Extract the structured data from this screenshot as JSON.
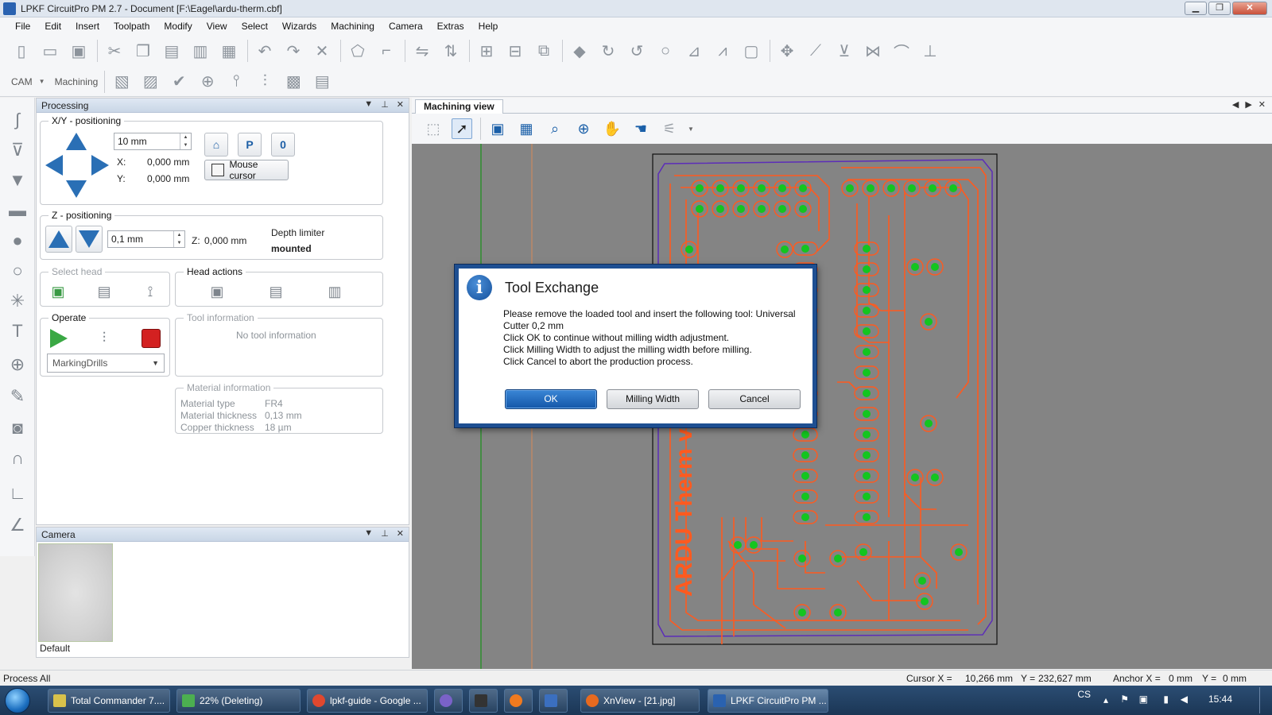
{
  "window": {
    "title": "LPKF CircuitPro PM 2.7 - Document [F:\\Eagel\\ardu-therm.cbf]",
    "min_label": "▁",
    "max_label": "❐",
    "close_label": "✕"
  },
  "menu": [
    "File",
    "Edit",
    "Insert",
    "Toolpath",
    "Modify",
    "View",
    "Select",
    "Wizards",
    "Machining",
    "Camera",
    "Extras",
    "Help"
  ],
  "toolbar2": {
    "cam_label": "CAM",
    "machining_label": "Machining"
  },
  "processing": {
    "panel_title": "Processing",
    "xy": {
      "title": "X/Y - positioning",
      "step_value": "10 mm",
      "x_label": "X:",
      "x_value": "0,000 mm",
      "y_label": "Y:",
      "y_value": "0,000 mm",
      "mouse_cursor_label": "Mouse cursor",
      "btn_p": "P",
      "btn_0": "0"
    },
    "z": {
      "title": "Z - positioning",
      "step_value": "0,1 mm",
      "z_label": "Z:",
      "z_value": "0,000 mm",
      "depth_limiter_label": "Depth limiter",
      "depth_limiter_value": "mounted"
    },
    "select_head_title": "Select head",
    "head_actions_title": "Head actions",
    "operate": {
      "title": "Operate",
      "selected_phase": "MarkingDrills"
    },
    "tool_info": {
      "title": "Tool information",
      "text": "No tool information"
    },
    "material_info": {
      "title": "Material information",
      "type_label": "Material type",
      "type_value": "FR4",
      "thickness_label": "Material thickness",
      "thickness_value": "0,13 mm",
      "copper_label": "Copper thickness",
      "copper_value": "18 µm"
    }
  },
  "camera": {
    "panel_title": "Camera",
    "default_label": "Default"
  },
  "machining_view": {
    "tab_label": "Machining view",
    "board_label": "ARDU Therm v1.0"
  },
  "dialog": {
    "title": "Tool Exchange",
    "line1": "Please remove the loaded tool and insert the following tool: Universal Cutter 0,2 mm",
    "line2": "Click OK to continue without milling width adjustment.",
    "line3": "Click Milling Width to adjust the milling width before milling.",
    "line4": "Click Cancel to abort the production process.",
    "ok": "OK",
    "milling_width": "Milling Width",
    "cancel": "Cancel"
  },
  "statusbar": {
    "left": "Process All",
    "cursor_x_label": "Cursor X =",
    "cursor_x": "10,266 mm",
    "cursor_y_label": "Y =",
    "cursor_y": "232,627 mm",
    "anchor_x_label": "Anchor X =",
    "anchor_x": "0 mm",
    "anchor_y_label": "Y =",
    "anchor_y": "0 mm"
  },
  "taskbar": {
    "items": [
      "Total Commander 7....",
      "22% (Deleting)",
      "lpkf-guide - Google ...",
      "XnView - [21.jpg]",
      "LPKF CircuitPro PM ..."
    ],
    "lang": "CS",
    "time": "15:44"
  },
  "colors": {
    "trace": "#ff5a1f",
    "pad": "#13c51f",
    "board_outline": "#5c2db8",
    "canvas": "#848484",
    "accent": "#1e4f92"
  }
}
